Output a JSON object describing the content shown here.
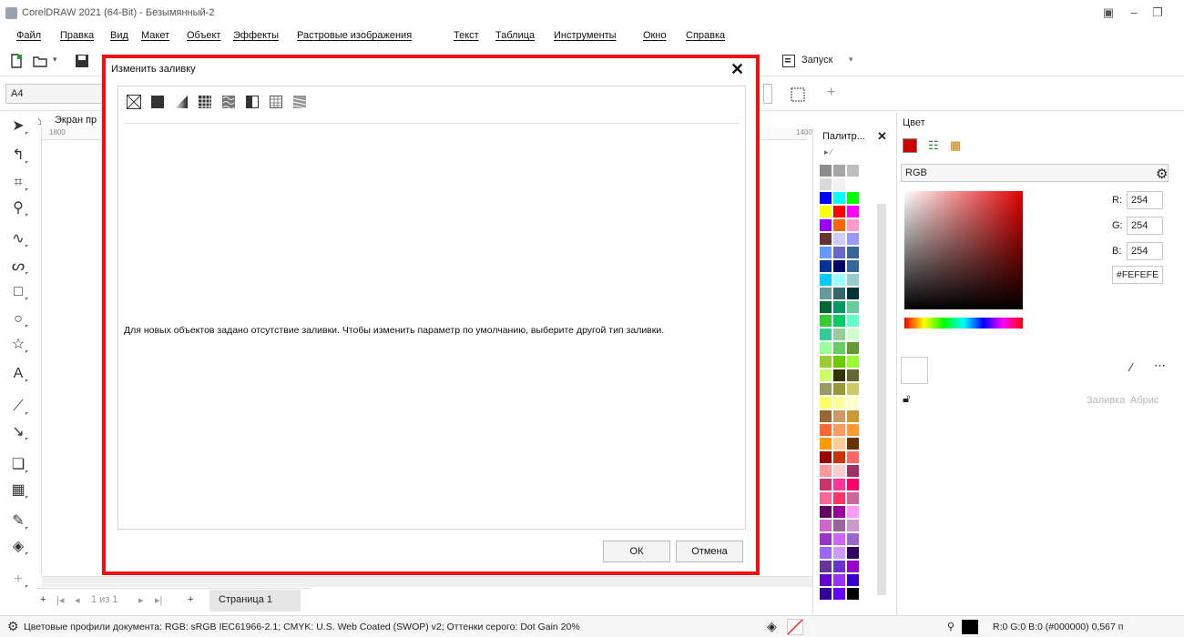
{
  "window": {
    "title": "CorelDRAW 2021 (64-Bit) - Безымянный-2"
  },
  "menu": [
    "Файл",
    "Правка",
    "Вид",
    "Макет",
    "Объект",
    "Эффекты",
    "Растровые изображения",
    "Текст",
    "Таблица",
    "Инструменты",
    "Окно",
    "Справка"
  ],
  "toolbar": {
    "launch_label": "Запуск"
  },
  "propbar": {
    "page_size": "A4"
  },
  "document_tab": {
    "label": "Экран пр"
  },
  "rulers": {
    "h_left": "1800",
    "h_right": "1400"
  },
  "page_nav": {
    "counter": "1 из 1",
    "page_tab": "Страница 1"
  },
  "dialog": {
    "title": "Изменить заливку",
    "fill_types": [
      "no-fill-icon",
      "uniform-fill-icon",
      "fountain-fill-icon",
      "vector-pattern-fill-icon",
      "bitmap-pattern-fill-icon",
      "two-color-pattern-fill-icon",
      "texture-fill-icon",
      "postscript-fill-icon"
    ],
    "message": "Для новых объектов задано отсутствие заливки. Чтобы изменить параметр по умолчанию, выберите другой тип заливки.",
    "ok_label": "ОК",
    "cancel_label": "Отмена"
  },
  "palette": {
    "title": "Палитр...",
    "colors": [
      [
        "#8c8c8c",
        "#a6a6a6",
        "#bfbfbf"
      ],
      [
        "#d9d9d9",
        "#f2f2f2",
        "#ffffff"
      ],
      [
        "#0000ff",
        "#00ffff",
        "#00ff00"
      ],
      [
        "#ffff00",
        "#ff0000",
        "#ff00ff"
      ],
      [
        "#9900ff",
        "#ff6600",
        "#ff99cc"
      ],
      [
        "#663333",
        "#ccccff",
        "#9999ff"
      ],
      [
        "#6699ff",
        "#6666cc",
        "#336699"
      ],
      [
        "#003399",
        "#000066",
        "#336699"
      ],
      [
        "#00ccff",
        "#99ffff",
        "#99cccc"
      ],
      [
        "#669999",
        "#336666",
        "#003333"
      ],
      [
        "#006633",
        "#009966",
        "#66cc99"
      ],
      [
        "#33cc33",
        "#00cc66",
        "#66ffcc"
      ],
      [
        "#33cc99",
        "#99cc99",
        "#ccffcc"
      ],
      [
        "#99ff99",
        "#66cc66",
        "#669933"
      ],
      [
        "#99cc33",
        "#66cc00",
        "#99ff33"
      ],
      [
        "#ccff66",
        "#333300",
        "#666633"
      ],
      [
        "#999966",
        "#999933",
        "#cccc66"
      ],
      [
        "#ffff66",
        "#ffff99",
        "#ffffcc"
      ],
      [
        "#996633",
        "#cc9966",
        "#cc9933"
      ],
      [
        "#ff6633",
        "#ff9966",
        "#ff9933"
      ],
      [
        "#ff9900",
        "#ffcc99",
        "#663300"
      ],
      [
        "#990000",
        "#cc3300",
        "#ff6666"
      ],
      [
        "#ff9999",
        "#ffcccc",
        "#993366"
      ],
      [
        "#cc3366",
        "#ff3399",
        "#ff0066"
      ],
      [
        "#ff6699",
        "#ff3366",
        "#cc6699"
      ],
      [
        "#660066",
        "#990099",
        "#ff99ff"
      ],
      [
        "#cc66cc",
        "#996699",
        "#cc99cc"
      ],
      [
        "#9933cc",
        "#cc66ff",
        "#9966cc"
      ],
      [
        "#9966ff",
        "#cc99ff",
        "#330066"
      ],
      [
        "#663399",
        "#6633cc",
        "#9900cc"
      ],
      [
        "#6600cc",
        "#9933ff",
        "#3300cc"
      ],
      [
        "#330099",
        "#6600ff",
        "#000000"
      ]
    ]
  },
  "color_panel": {
    "title": "Цвет",
    "model": "RGB",
    "r_label": "R:",
    "g_label": "G:",
    "b_label": "B:",
    "r": "254",
    "g": "254",
    "b": "254",
    "hex": "#FEFEFE",
    "fill_label": "Заливка",
    "outline_label": "Абрис"
  },
  "status": {
    "color_profiles": "Цветовые профили документа: RGB: sRGB IEC61966-2.1; CMYK: U.S. Web Coated (SWOP) v2; Оттенки серого: Dot Gain 20%",
    "fill_info": "R:0 G:0 B:0 (#000000) 0,567 п"
  },
  "colors": {
    "dialog_highlight": "#ee1111"
  }
}
